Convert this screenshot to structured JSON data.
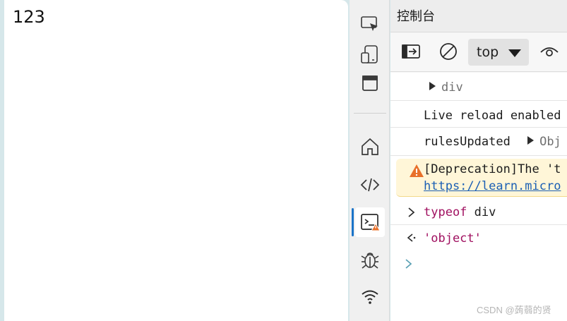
{
  "page": {
    "content_text": "123"
  },
  "activity_bar": {
    "items": [
      {
        "name": "inspect-icon"
      },
      {
        "name": "device-emulation-icon"
      },
      {
        "name": "dock-icon"
      },
      {
        "name": "welcome-home-icon"
      },
      {
        "name": "elements-code-icon"
      },
      {
        "name": "console-icon",
        "active": true,
        "badge": "warning"
      },
      {
        "name": "sources-bug-icon"
      },
      {
        "name": "network-wifi-icon"
      }
    ]
  },
  "devtools": {
    "panel_title": "控制台",
    "toolbar": {
      "context_selected": "top"
    },
    "console_rows": [
      {
        "type": "object",
        "text": "div"
      },
      {
        "type": "log",
        "text": "Live reload enabled"
      },
      {
        "type": "log",
        "text": "rulesUpdated",
        "object_label": "Obj"
      },
      {
        "type": "warning",
        "text": "[Deprecation]The 't",
        "link": "https://learn.micro"
      },
      {
        "type": "input",
        "keyword": "typeof",
        "text": " div"
      },
      {
        "type": "result",
        "text": "'object'"
      },
      {
        "type": "prompt",
        "text": ""
      }
    ]
  },
  "colors": {
    "accent": "#1a73c8",
    "warning": "#e8702a",
    "warning_bg": "#fff6d8",
    "string": "#a01060",
    "link": "#1a5fb4"
  },
  "watermark": "CSDN @蒟蒻的贤"
}
